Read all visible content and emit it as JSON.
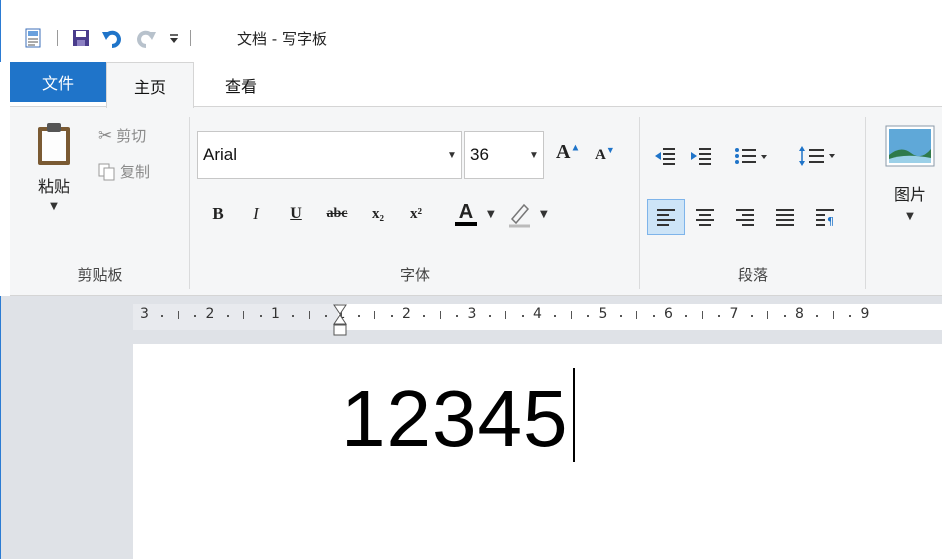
{
  "window": {
    "title": "文档 - 写字板"
  },
  "quick_access": {
    "icons": [
      "app-icon",
      "save-icon",
      "undo-icon",
      "redo-icon",
      "customize-icon"
    ]
  },
  "tabs": [
    {
      "label": "文件"
    },
    {
      "label": "主页"
    },
    {
      "label": "查看"
    }
  ],
  "clipboard": {
    "paste_label": "粘贴",
    "cut_label": "剪切",
    "copy_label": "复制",
    "group_label": "剪贴板"
  },
  "font": {
    "family": "Arial",
    "size": "36",
    "group_label": "字体",
    "format_buttons": [
      "B",
      "I",
      "U",
      "abc",
      "x₂",
      "x²",
      "A"
    ]
  },
  "paragraph": {
    "group_label": "段落"
  },
  "insert": {
    "picture_label": "图片"
  },
  "ruler": {
    "marks": [
      "3",
      "2",
      "1",
      "1",
      "2",
      "3",
      "4",
      "5",
      "6",
      "7",
      "8",
      "9"
    ]
  },
  "document": {
    "text": "12345"
  },
  "colors": {
    "accent": "#1f74c9",
    "ribbon_bg": "#f5f6f7",
    "workspace_bg": "#dfe2e7"
  }
}
